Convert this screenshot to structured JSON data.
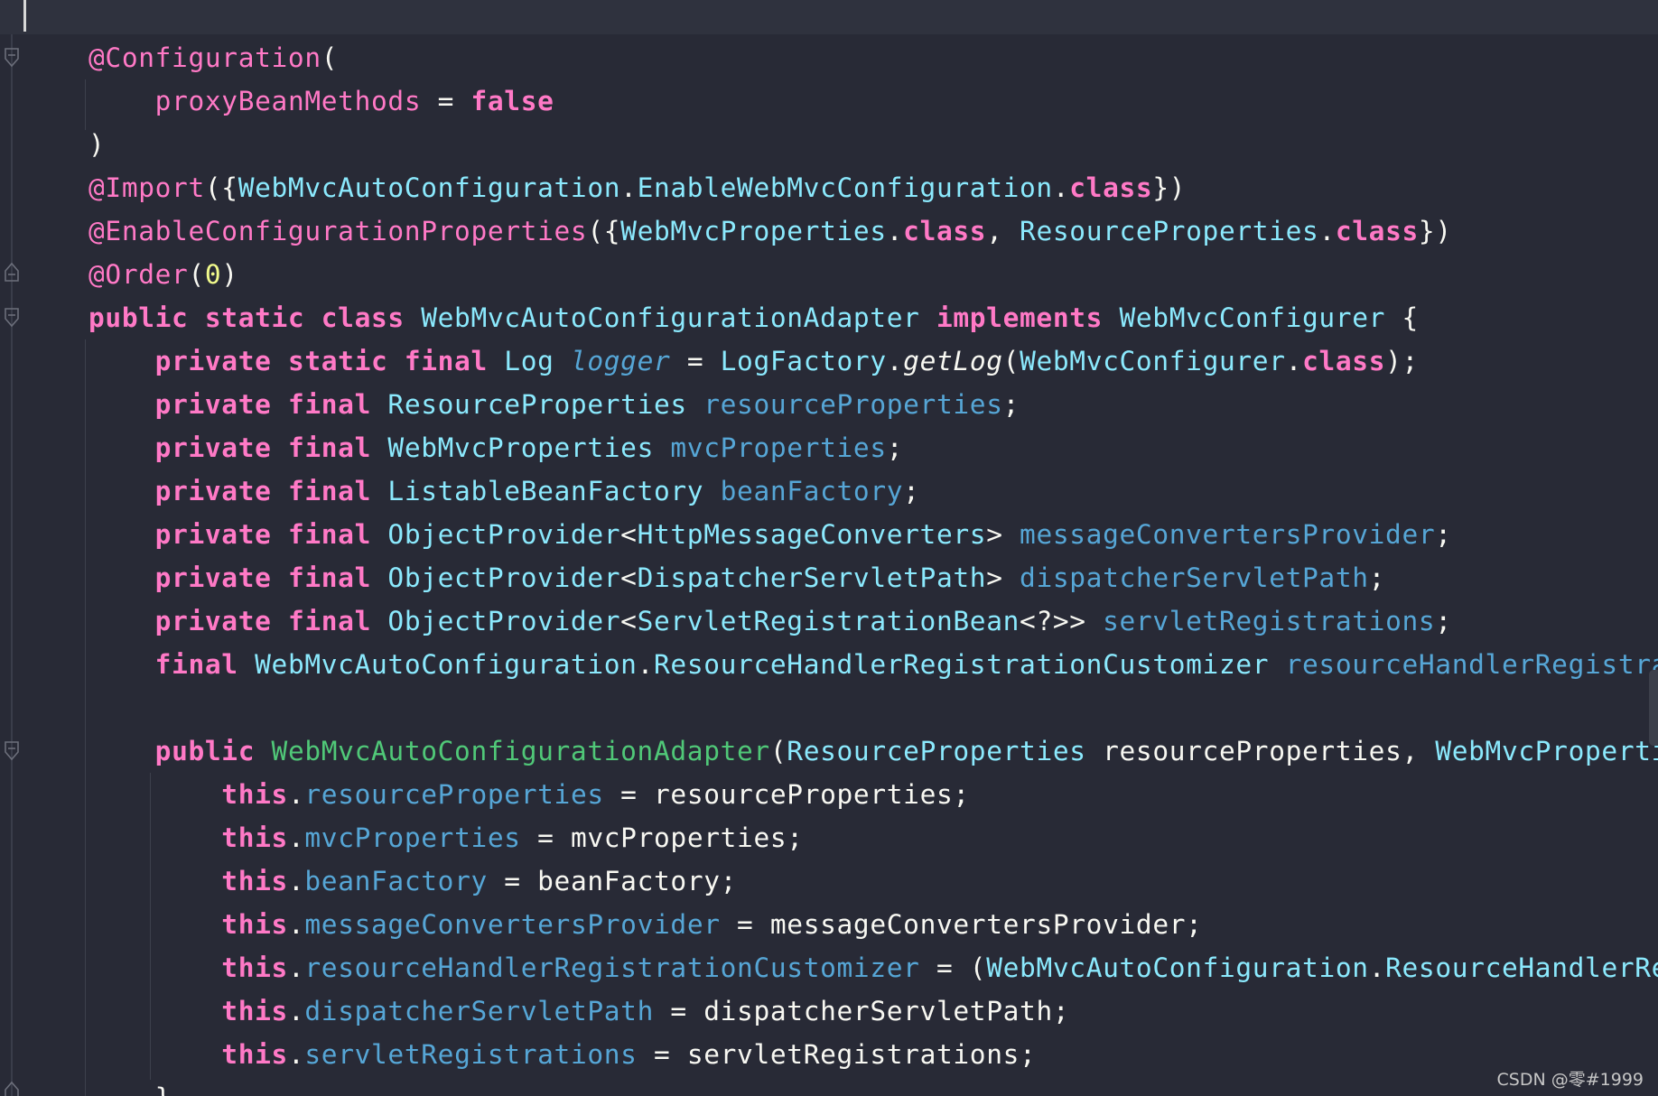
{
  "colors": {
    "background": "#282a36",
    "keyword": "#ff79c6",
    "type": "#8be9fd",
    "field": "#56a6d6",
    "constructor": "#50c878",
    "text": "#f8f8f2",
    "number": "#f1fa8c"
  },
  "icons": [
    "fold-marker-icon",
    "text-caret-icon"
  ],
  "code_lines": [
    [
      {
        "t": "@Configuration",
        "c": "kw"
      },
      {
        "t": "(",
        "c": "pl"
      }
    ],
    [
      {
        "t": "    ",
        "c": "pl"
      },
      {
        "t": "proxyBeanMethods",
        "c": "kw"
      },
      {
        "t": " = ",
        "c": "pl"
      },
      {
        "t": "false",
        "c": "kwb"
      }
    ],
    [
      {
        "t": ")",
        "c": "pl"
      }
    ],
    [
      {
        "t": "@Import",
        "c": "kw"
      },
      {
        "t": "({",
        "c": "pl"
      },
      {
        "t": "WebMvcAutoConfiguration",
        "c": "ty"
      },
      {
        "t": ".",
        "c": "pl"
      },
      {
        "t": "EnableWebMvcConfiguration",
        "c": "ty"
      },
      {
        "t": ".",
        "c": "pl"
      },
      {
        "t": "class",
        "c": "kwb"
      },
      {
        "t": "})",
        "c": "pl"
      }
    ],
    [
      {
        "t": "@EnableConfigurationProperties",
        "c": "kw"
      },
      {
        "t": "({",
        "c": "pl"
      },
      {
        "t": "WebMvcProperties",
        "c": "ty"
      },
      {
        "t": ".",
        "c": "pl"
      },
      {
        "t": "class",
        "c": "kwb"
      },
      {
        "t": ", ",
        "c": "pl"
      },
      {
        "t": "ResourceProperties",
        "c": "ty"
      },
      {
        "t": ".",
        "c": "pl"
      },
      {
        "t": "class",
        "c": "kwb"
      },
      {
        "t": "})",
        "c": "pl"
      }
    ],
    [
      {
        "t": "@Order",
        "c": "kw"
      },
      {
        "t": "(",
        "c": "pl"
      },
      {
        "t": "0",
        "c": "num"
      },
      {
        "t": ")",
        "c": "pl"
      }
    ],
    [
      {
        "t": "public static class ",
        "c": "kwb"
      },
      {
        "t": "WebMvcAutoConfigurationAdapter ",
        "c": "ty"
      },
      {
        "t": "implements ",
        "c": "kwb"
      },
      {
        "t": "WebMvcConfigurer",
        "c": "ty"
      },
      {
        "t": " {",
        "c": "pl"
      }
    ],
    [
      {
        "t": "    ",
        "c": "pl"
      },
      {
        "t": "private static final ",
        "c": "kwb"
      },
      {
        "t": "Log ",
        "c": "ty"
      },
      {
        "t": "logger",
        "c": "fi"
      },
      {
        "t": " = ",
        "c": "pl"
      },
      {
        "t": "LogFactory",
        "c": "ty"
      },
      {
        "t": ".",
        "c": "pl"
      },
      {
        "t": "getLog",
        "c": "it"
      },
      {
        "t": "(",
        "c": "pl"
      },
      {
        "t": "WebMvcConfigurer",
        "c": "ty"
      },
      {
        "t": ".",
        "c": "pl"
      },
      {
        "t": "class",
        "c": "kwb"
      },
      {
        "t": ");",
        "c": "pl"
      }
    ],
    [
      {
        "t": "    ",
        "c": "pl"
      },
      {
        "t": "private final ",
        "c": "kwb"
      },
      {
        "t": "ResourceProperties ",
        "c": "ty"
      },
      {
        "t": "resourceProperties",
        "c": "fd"
      },
      {
        "t": ";",
        "c": "pl"
      }
    ],
    [
      {
        "t": "    ",
        "c": "pl"
      },
      {
        "t": "private final ",
        "c": "kwb"
      },
      {
        "t": "WebMvcProperties ",
        "c": "ty"
      },
      {
        "t": "mvcProperties",
        "c": "fd"
      },
      {
        "t": ";",
        "c": "pl"
      }
    ],
    [
      {
        "t": "    ",
        "c": "pl"
      },
      {
        "t": "private final ",
        "c": "kwb"
      },
      {
        "t": "ListableBeanFactory ",
        "c": "ty"
      },
      {
        "t": "beanFactory",
        "c": "fd"
      },
      {
        "t": ";",
        "c": "pl"
      }
    ],
    [
      {
        "t": "    ",
        "c": "pl"
      },
      {
        "t": "private final ",
        "c": "kwb"
      },
      {
        "t": "ObjectProvider",
        "c": "ty"
      },
      {
        "t": "<",
        "c": "pl"
      },
      {
        "t": "HttpMessageConverters",
        "c": "ty"
      },
      {
        "t": "> ",
        "c": "pl"
      },
      {
        "t": "messageConvertersProvider",
        "c": "fd"
      },
      {
        "t": ";",
        "c": "pl"
      }
    ],
    [
      {
        "t": "    ",
        "c": "pl"
      },
      {
        "t": "private final ",
        "c": "kwb"
      },
      {
        "t": "ObjectProvider",
        "c": "ty"
      },
      {
        "t": "<",
        "c": "pl"
      },
      {
        "t": "DispatcherServletPath",
        "c": "ty"
      },
      {
        "t": "> ",
        "c": "pl"
      },
      {
        "t": "dispatcherServletPath",
        "c": "fd"
      },
      {
        "t": ";",
        "c": "pl"
      }
    ],
    [
      {
        "t": "    ",
        "c": "pl"
      },
      {
        "t": "private final ",
        "c": "kwb"
      },
      {
        "t": "ObjectProvider",
        "c": "ty"
      },
      {
        "t": "<",
        "c": "pl"
      },
      {
        "t": "ServletRegistrationBean",
        "c": "ty"
      },
      {
        "t": "<?>> ",
        "c": "pl"
      },
      {
        "t": "servletRegistrations",
        "c": "fd"
      },
      {
        "t": ";",
        "c": "pl"
      }
    ],
    [
      {
        "t": "    ",
        "c": "pl"
      },
      {
        "t": "final ",
        "c": "kwb"
      },
      {
        "t": "WebMvcAutoConfiguration",
        "c": "ty"
      },
      {
        "t": ".",
        "c": "pl"
      },
      {
        "t": "ResourceHandlerRegistrationCustomizer ",
        "c": "ty"
      },
      {
        "t": "resourceHandlerRegistrati",
        "c": "fd"
      }
    ],
    [],
    [
      {
        "t": "    ",
        "c": "pl"
      },
      {
        "t": "public ",
        "c": "kwb"
      },
      {
        "t": "WebMvcAutoConfigurationAdapter",
        "c": "ct"
      },
      {
        "t": "(",
        "c": "pl"
      },
      {
        "t": "ResourceProperties ",
        "c": "ty"
      },
      {
        "t": "resourceProperties, ",
        "c": "pl"
      },
      {
        "t": "WebMvcPropertie",
        "c": "ty"
      }
    ],
    [
      {
        "t": "        ",
        "c": "pl"
      },
      {
        "t": "this",
        "c": "kwb"
      },
      {
        "t": ".",
        "c": "pl"
      },
      {
        "t": "resourceProperties",
        "c": "fd"
      },
      {
        "t": " = resourceProperties;",
        "c": "pl"
      }
    ],
    [
      {
        "t": "        ",
        "c": "pl"
      },
      {
        "t": "this",
        "c": "kwb"
      },
      {
        "t": ".",
        "c": "pl"
      },
      {
        "t": "mvcProperties",
        "c": "fd"
      },
      {
        "t": " = mvcProperties;",
        "c": "pl"
      }
    ],
    [
      {
        "t": "        ",
        "c": "pl"
      },
      {
        "t": "this",
        "c": "kwb"
      },
      {
        "t": ".",
        "c": "pl"
      },
      {
        "t": "beanFactory",
        "c": "fd"
      },
      {
        "t": " = beanFactory;",
        "c": "pl"
      }
    ],
    [
      {
        "t": "        ",
        "c": "pl"
      },
      {
        "t": "this",
        "c": "kwb"
      },
      {
        "t": ".",
        "c": "pl"
      },
      {
        "t": "messageConvertersProvider",
        "c": "fd"
      },
      {
        "t": " = messageConvertersProvider;",
        "c": "pl"
      }
    ],
    [
      {
        "t": "        ",
        "c": "pl"
      },
      {
        "t": "this",
        "c": "kwb"
      },
      {
        "t": ".",
        "c": "pl"
      },
      {
        "t": "resourceHandlerRegistrationCustomizer",
        "c": "fd"
      },
      {
        "t": " = (",
        "c": "pl"
      },
      {
        "t": "WebMvcAutoConfiguration",
        "c": "ty"
      },
      {
        "t": ".",
        "c": "pl"
      },
      {
        "t": "ResourceHandlerRegi",
        "c": "ty"
      }
    ],
    [
      {
        "t": "        ",
        "c": "pl"
      },
      {
        "t": "this",
        "c": "kwb"
      },
      {
        "t": ".",
        "c": "pl"
      },
      {
        "t": "dispatcherServletPath",
        "c": "fd"
      },
      {
        "t": " = dispatcherServletPath;",
        "c": "pl"
      }
    ],
    [
      {
        "t": "        ",
        "c": "pl"
      },
      {
        "t": "this",
        "c": "kwb"
      },
      {
        "t": ".",
        "c": "pl"
      },
      {
        "t": "servletRegistrations",
        "c": "fd"
      },
      {
        "t": " = servletRegistrations;",
        "c": "pl"
      }
    ],
    [
      {
        "t": "    }",
        "c": "pl"
      }
    ]
  ],
  "watermark": "CSDN @零#1999"
}
